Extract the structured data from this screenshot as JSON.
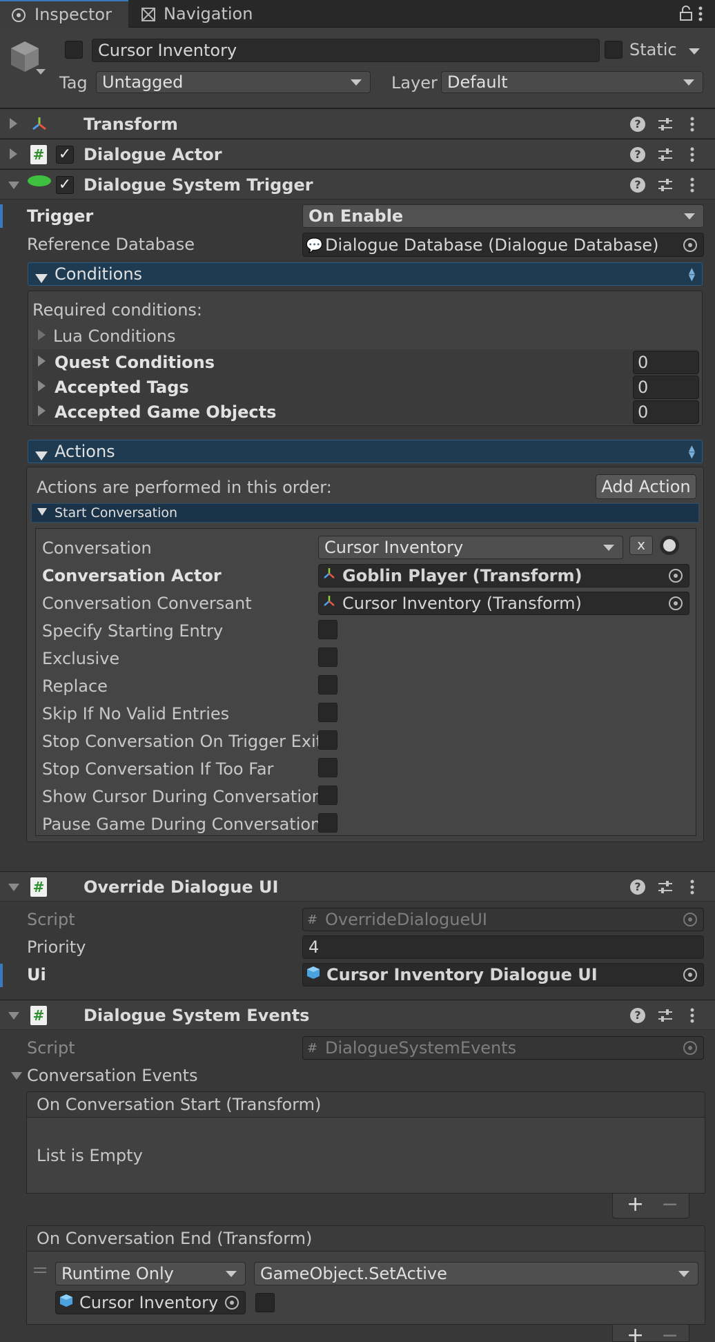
{
  "tabs": {
    "inspector": "Inspector",
    "navigation": "Navigation"
  },
  "header": {
    "name": "Cursor Inventory",
    "static_label": "Static",
    "tag_label": "Tag",
    "tag_value": "Untagged",
    "layer_label": "Layer",
    "layer_value": "Default"
  },
  "components": {
    "transform": "Transform",
    "dialogue_actor": "Dialogue Actor",
    "dst": {
      "title": "Dialogue System Trigger",
      "trigger_label": "Trigger",
      "trigger_value": "On Enable",
      "refdb_label": "Reference Database",
      "refdb_value": "Dialogue Database (Dialogue Database)",
      "conditions": {
        "title": "Conditions",
        "required": "Required conditions:",
        "lua": "Lua Conditions",
        "rows": [
          {
            "label": "Quest Conditions",
            "value": "0"
          },
          {
            "label": "Accepted Tags",
            "value": "0"
          },
          {
            "label": "Accepted Game Objects",
            "value": "0"
          }
        ]
      },
      "actions": {
        "title": "Actions",
        "order_text": "Actions are performed in this order:",
        "add_action": "Add Action",
        "start_conv": {
          "title": "Start Conversation",
          "conversation_label": "Conversation",
          "conversation_value": "Cursor Inventory",
          "clear": "x",
          "actor_label": "Conversation Actor",
          "actor_value": "Goblin Player (Transform)",
          "conversant_label": "Conversation Conversant",
          "conversant_value": "Cursor Inventory (Transform)",
          "checkboxes": [
            "Specify Starting Entry",
            "Exclusive",
            "Replace",
            "Skip If No Valid Entries",
            "Stop Conversation On Trigger Exit",
            "Stop Conversation If Too Far",
            "Show Cursor During Conversation",
            "Pause Game During Conversation"
          ]
        }
      }
    },
    "odui": {
      "title": "Override Dialogue UI",
      "script_label": "Script",
      "script_value": "OverrideDialogueUI",
      "priority_label": "Priority",
      "priority_value": "4",
      "ui_label": "Ui",
      "ui_value": "Cursor Inventory Dialogue UI"
    },
    "dse": {
      "title": "Dialogue System Events",
      "script_label": "Script",
      "script_value": "DialogueSystemEvents",
      "conv_events": "Conversation Events",
      "start_event": {
        "title": "On Conversation Start (Transform)",
        "empty": "List is Empty"
      },
      "end_event": {
        "title": "On Conversation End (Transform)",
        "runtime": "Runtime Only",
        "function": "GameObject.SetActive",
        "object": "Cursor Inventory"
      },
      "plus": "+",
      "minus": "−"
    }
  },
  "colors": {
    "bg": "#383838",
    "header": "#3e3e3e",
    "accent": "#3a79bb",
    "foldout": "#1e3b52"
  }
}
